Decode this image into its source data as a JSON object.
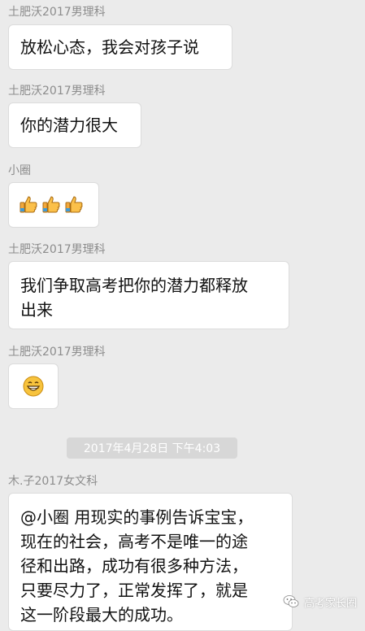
{
  "messages": [
    {
      "sender": "土肥沃2017男理科",
      "text": "放松心态，我会对孩子说"
    },
    {
      "sender": "土肥沃2017男理科",
      "text": "你的潜力很大"
    },
    {
      "sender": "小圈",
      "emoji": "thumbs-up-icon x3"
    },
    {
      "sender": "土肥沃2017男理科",
      "line1": "我们争取高考把你的潜力都释放",
      "line2": "出来"
    },
    {
      "sender": "土肥沃2017男理科",
      "emoji": "grinning-face-icon"
    },
    {
      "sender": "木.子2017女文科",
      "lines": [
        "@小圈 用现实的事例告诉宝宝，",
        "现在的社会，高考不是唯一的途",
        "径和出路，成功有很多种方法，",
        "只要尽力了，正常发挥了，就是",
        "这一阶段最大的成功。"
      ]
    }
  ],
  "timestamp": "2017年4月28日 下午4:03",
  "watermark": {
    "text": "高考家长圈"
  },
  "colors": {
    "background": "#ebebeb",
    "bubble": "#ffffff",
    "sender": "#8c8c8c",
    "timestamp_bg": "#d7d7d7"
  }
}
